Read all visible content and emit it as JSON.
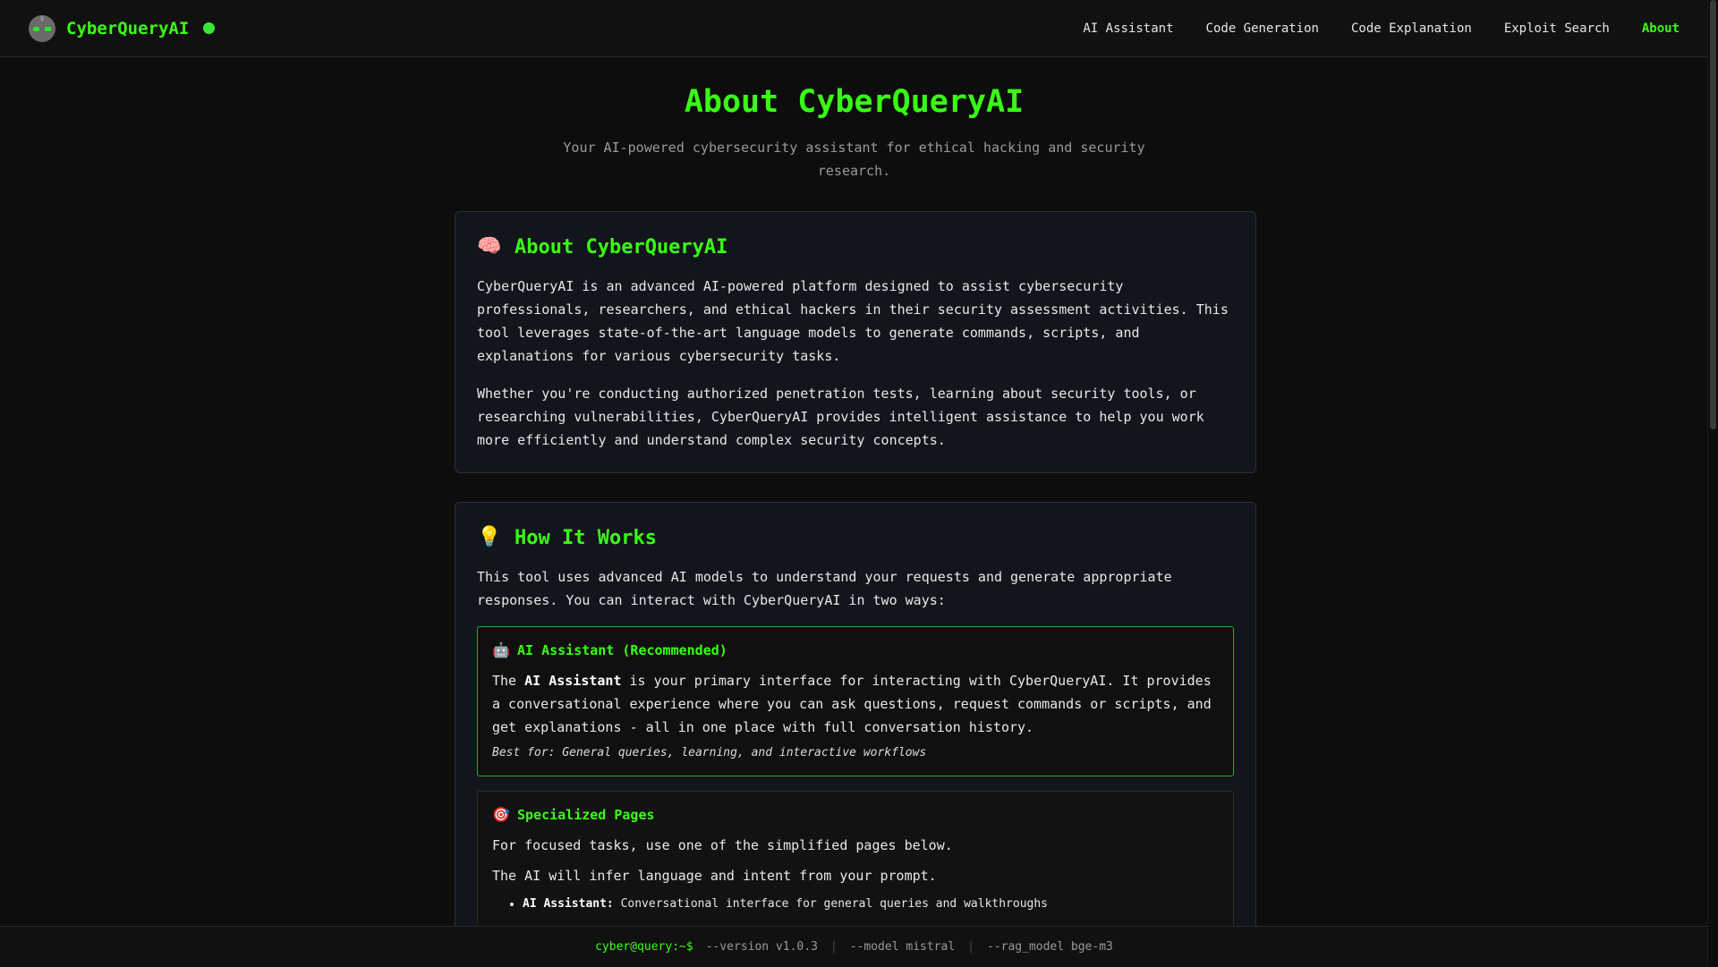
{
  "brand": {
    "name": "CyberQueryAI",
    "status_color": "#39e639",
    "accent": "#39ff14"
  },
  "nav": {
    "links": [
      {
        "label": "AI Assistant",
        "active": false
      },
      {
        "label": "Code Generation",
        "active": false
      },
      {
        "label": "Code Explanation",
        "active": false
      },
      {
        "label": "Exploit Search",
        "active": false
      },
      {
        "label": "About",
        "active": true
      }
    ]
  },
  "page": {
    "title": "About CyberQueryAI",
    "subtitle": "Your AI-powered cybersecurity assistant for ethical hacking and security research."
  },
  "about_card": {
    "icon": "brain-icon",
    "title": "About CyberQueryAI",
    "paragraphs": [
      "CyberQueryAI is an advanced AI-powered platform designed to assist cybersecurity professionals, researchers, and ethical hackers in their security assessment activities. This tool leverages state-of-the-art language models to generate commands, scripts, and explanations for various cybersecurity tasks.",
      "Whether you're conducting authorized penetration tests, learning about security tools, or researching vulnerabilities, CyberQueryAI provides intelligent assistance to help you work more efficiently and understand complex security concepts."
    ]
  },
  "how_card": {
    "icon": "lightbulb-icon",
    "title": "How It Works",
    "intro": "This tool uses advanced AI models to understand your requests and generate appropriate responses. You can interact with CyberQueryAI in two ways:",
    "assistant_box": {
      "icon": "robot-icon",
      "title": "AI Assistant (Recommended)",
      "text_prefix": "The ",
      "text_bold": "AI Assistant",
      "text_suffix": " is your primary interface for interacting with CyberQueryAI. It provides a conversational experience where you can ask questions, request commands or scripts, and get explanations - all in one place with full conversation history.",
      "best_for": "Best for: General queries, learning, and interactive workflows"
    },
    "specialized_box": {
      "icon": "target-icon",
      "title": "Specialized Pages",
      "line1": "For focused tasks, use one of the simplified pages below.",
      "line2": "The AI will infer language and intent from your prompt.",
      "items": [
        {
          "bold": "AI Assistant:",
          "text": " Conversational interface for general queries and walkthroughs"
        }
      ]
    }
  },
  "footer": {
    "prompt": "cyber@query:~$",
    "version": "--version v1.0.3",
    "model": "--model mistral",
    "rag_model": "--rag_model bge-m3"
  }
}
